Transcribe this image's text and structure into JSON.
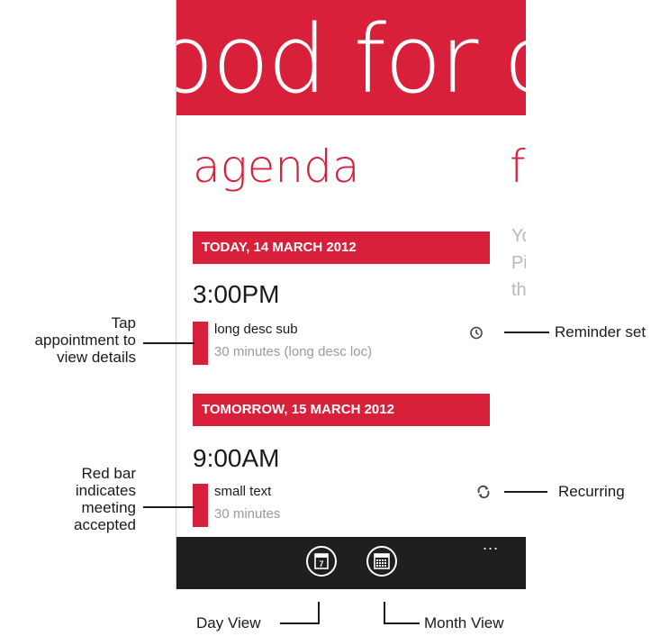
{
  "header": {
    "title": "ood for c"
  },
  "pivot": {
    "current": "agenda",
    "next": "f"
  },
  "peek_lines": [
    "Yo",
    "Pi",
    "th"
  ],
  "days": [
    {
      "date_label": "TODAY, 14 MARCH 2012",
      "time": "3:00PM",
      "subject": "long desc sub",
      "detail": "30 minutes (long desc loc)",
      "status_icon": "alarm-clock-icon"
    },
    {
      "date_label": "TOMORROW, 15 MARCH 2012",
      "time": "9:00AM",
      "subject": "small text",
      "detail": "30 minutes",
      "status_icon": "recurring-icon"
    }
  ],
  "app_bar": {
    "more": "...",
    "buttons": [
      "day-view-icon",
      "month-view-icon"
    ]
  },
  "callouts": {
    "tap": [
      "Tap",
      "appointment to",
      "view details"
    ],
    "red_bar": [
      "Red bar",
      "indicates",
      "meeting",
      "accepted"
    ],
    "reminder": "Reminder set",
    "recurring": "Recurring",
    "day_view": "Day View",
    "month_view": "Month View"
  },
  "colors": {
    "accent": "#d9203a",
    "app_bar": "#1f1f1f",
    "secondary_text": "#9a9a9a"
  }
}
